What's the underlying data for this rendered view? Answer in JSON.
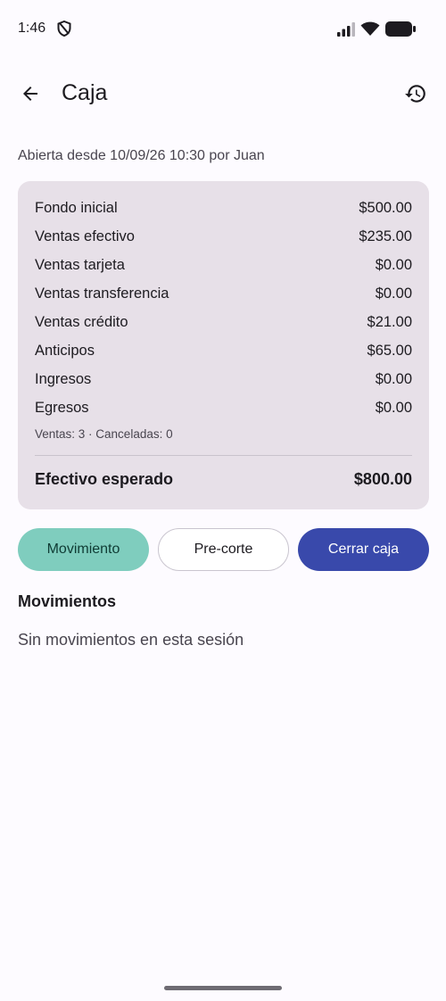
{
  "status_bar": {
    "time": "1:46",
    "icons": [
      "shield-icon",
      "signal-icon",
      "wifi-icon",
      "battery-icon"
    ]
  },
  "header": {
    "title": "Caja",
    "back_icon": "arrow-back-icon",
    "history_icon": "history-icon"
  },
  "session": {
    "info": "Abierta desde 10/09/26 10:30 por Juan"
  },
  "summary": {
    "rows": [
      {
        "label": "Fondo inicial",
        "value": "$500.00"
      },
      {
        "label": "Ventas efectivo",
        "value": "$235.00"
      },
      {
        "label": "Ventas tarjeta",
        "value": "$0.00"
      },
      {
        "label": "Ventas transferencia",
        "value": "$0.00"
      },
      {
        "label": "Ventas crédito",
        "value": "$21.00"
      },
      {
        "label": "Anticipos",
        "value": "$65.00"
      },
      {
        "label": "Ingresos",
        "value": "$0.00"
      },
      {
        "label": "Egresos",
        "value": "$0.00"
      }
    ],
    "counts": "Ventas: 3 · Canceladas: 0",
    "expected_label": "Efectivo esperado",
    "expected_value": "$800.00"
  },
  "actions": {
    "movimiento": "Movimiento",
    "precorte": "Pre-corte",
    "cerrar": "Cerrar caja"
  },
  "movements": {
    "title": "Movimientos",
    "empty": "Sin movimientos en esta sesión"
  },
  "colors": {
    "card_bg": "#e7e0e8",
    "movimiento_bg": "#7fcdbe",
    "cerrar_bg": "#3949ab"
  }
}
